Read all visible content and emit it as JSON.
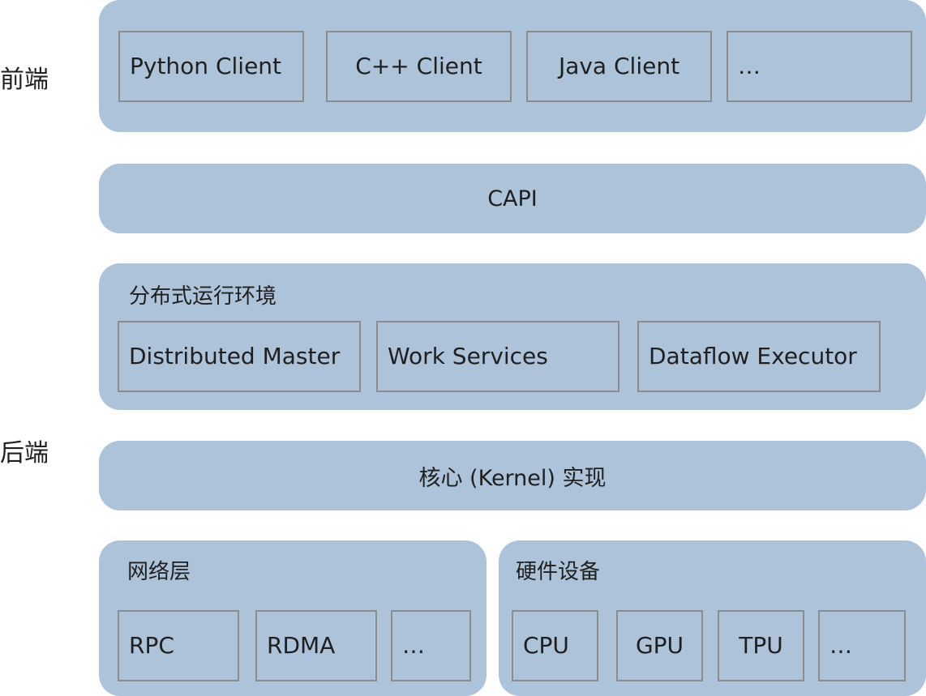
{
  "side_labels": {
    "frontend": "前端",
    "backend": "后端"
  },
  "clients": [
    "Python Client",
    "C++ Client",
    "Java Client",
    "…"
  ],
  "capi": {
    "label": "CAPI"
  },
  "distributed_runtime": {
    "title": "分布式运行环境",
    "items": [
      "Distributed Master",
      "Work Services",
      "Dataflow Executor"
    ]
  },
  "kernel": {
    "label": "核心 (Kernel) 实现"
  },
  "network": {
    "title": "网络层",
    "items": [
      "RPC",
      "RDMA",
      "…"
    ]
  },
  "hardware": {
    "title": "硬件设备",
    "items": [
      "CPU",
      "GPU",
      "TPU",
      "…"
    ]
  }
}
